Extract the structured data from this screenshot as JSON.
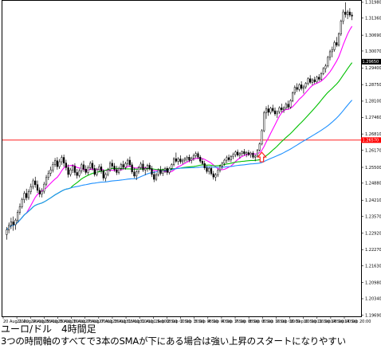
{
  "caption": {
    "title": "ユーロ/ドル　4時間足",
    "subtitle": "3つの時間軸のすべてで3本のSMAが下にある場合は強い上昇のスタートになりやすい"
  },
  "colors": {
    "background": "#ffffff",
    "candle_bull": "#ffffff",
    "candle_bear": "#000000",
    "candle_outline": "#000000",
    "sma_short": "#ff00ff",
    "sma_medium": "#00c000",
    "sma_long": "#1e90ff",
    "level_line": "#ff0000",
    "current_price_tag": "#000000",
    "arrow": "#ff2020"
  },
  "chart_data": {
    "type": "candlestick",
    "symbol": "EURUSD",
    "timeframe": "4H",
    "grid": false,
    "ylim": [
      1.1965,
      1.3204
    ],
    "y_ticks": [
      1.3198,
      1.3136,
      1.3069,
      1.3007,
      1.294,
      1.2875,
      1.281,
      1.2746,
      1.2681,
      1.2617,
      1.255,
      1.2488,
      1.2421,
      1.2357,
      1.2292,
      1.2227,
      1.2163,
      1.2098,
      1.2034,
      1.1969
    ],
    "y_tick_labels": [
      "1.31980",
      "1.31360",
      "1.30690",
      "1.30070",
      "1.29400",
      "1.28750",
      "1.28100",
      "1.27460",
      "1.26810",
      "1.26170",
      "1.25500",
      "1.24880",
      "1.24210",
      "1.23570",
      "1.22920",
      "1.22270",
      "1.21630",
      "1.20980",
      "1.20340",
      "1.19690"
    ],
    "x_tick_labels": [
      "20 Aug 2020",
      "21 Aug 16:00",
      "24 Aug 08:00",
      "25 Aug 00:00",
      "25 Aug 16:00",
      "26 Aug 08:00",
      "27 Aug 00:00",
      "27 Aug 16:00",
      "28 Aug 08:00",
      "31 Aug 00:00",
      "31 Aug 16:00",
      "1 Sep 08:00",
      "2 Sep 00:00",
      "2 Sep 16:00",
      "3 Sep 08:00",
      "4 Sep 00:00",
      "4 Sep 16:00",
      "7 Sep 08:00",
      "8 Sep 00:00",
      "8 Sep 16:00",
      "9 Sep 08:00",
      "10 Sep 00:00",
      "10 Sep 16:00",
      "11 Sep 08:00",
      "14 Sep 00:00",
      "14 Sep 20:00"
    ],
    "level_line": 1.2657,
    "level_line_label": "1.26570",
    "current_price_label": "1.29650",
    "current_price": 1.2965,
    "arrow": {
      "bar": 116,
      "price": 1.2578,
      "direction": "up"
    },
    "ohlc": [
      [
        1.2286,
        1.2316,
        1.2266,
        1.2305
      ],
      [
        1.2305,
        1.2333,
        1.2291,
        1.2322
      ],
      [
        1.2322,
        1.2352,
        1.2308,
        1.2336
      ],
      [
        1.2336,
        1.2357,
        1.2301,
        1.2325
      ],
      [
        1.2325,
        1.2349,
        1.2305,
        1.2343
      ],
      [
        1.2343,
        1.2383,
        1.2333,
        1.2374
      ],
      [
        1.2374,
        1.2408,
        1.2364,
        1.2396
      ],
      [
        1.2396,
        1.2431,
        1.2388,
        1.2423
      ],
      [
        1.2423,
        1.2457,
        1.241,
        1.2448
      ],
      [
        1.2448,
        1.2466,
        1.242,
        1.2431
      ],
      [
        1.2431,
        1.2464,
        1.2422,
        1.2455
      ],
      [
        1.2455,
        1.2486,
        1.2444,
        1.2474
      ],
      [
        1.2474,
        1.2506,
        1.2464,
        1.2497
      ],
      [
        1.2497,
        1.2513,
        1.247,
        1.2482
      ],
      [
        1.2482,
        1.2498,
        1.245,
        1.246
      ],
      [
        1.246,
        1.2471,
        1.2433,
        1.2445
      ],
      [
        1.2445,
        1.2468,
        1.2432,
        1.2456
      ],
      [
        1.2456,
        1.2493,
        1.2447,
        1.2484
      ],
      [
        1.2484,
        1.252,
        1.2476,
        1.251
      ],
      [
        1.251,
        1.2538,
        1.25,
        1.2527
      ],
      [
        1.2527,
        1.2553,
        1.2515,
        1.254
      ],
      [
        1.254,
        1.2572,
        1.253,
        1.2561
      ],
      [
        1.2561,
        1.2587,
        1.2552,
        1.2576
      ],
      [
        1.2576,
        1.259,
        1.2541,
        1.2553
      ],
      [
        1.2553,
        1.2583,
        1.2544,
        1.2572
      ],
      [
        1.2572,
        1.2598,
        1.256,
        1.2589
      ],
      [
        1.2589,
        1.26,
        1.2552,
        1.2567
      ],
      [
        1.2567,
        1.258,
        1.2538,
        1.2549
      ],
      [
        1.2549,
        1.2561,
        1.251,
        1.2522
      ],
      [
        1.2522,
        1.2548,
        1.2514,
        1.254
      ],
      [
        1.254,
        1.2562,
        1.2528,
        1.2554
      ],
      [
        1.2554,
        1.2566,
        1.2518,
        1.253
      ],
      [
        1.253,
        1.2544,
        1.2506,
        1.2518
      ],
      [
        1.2518,
        1.2545,
        1.251,
        1.2536
      ],
      [
        1.2536,
        1.2568,
        1.2526,
        1.256
      ],
      [
        1.256,
        1.2576,
        1.2532,
        1.2543
      ],
      [
        1.2543,
        1.2558,
        1.2521,
        1.253
      ],
      [
        1.253,
        1.2558,
        1.252,
        1.2549
      ],
      [
        1.2549,
        1.2574,
        1.254,
        1.2566
      ],
      [
        1.2566,
        1.2578,
        1.2537,
        1.2546
      ],
      [
        1.2546,
        1.256,
        1.2514,
        1.2522
      ],
      [
        1.2522,
        1.2548,
        1.2515,
        1.2541
      ],
      [
        1.2541,
        1.2562,
        1.2532,
        1.2552
      ],
      [
        1.2552,
        1.2564,
        1.2525,
        1.2535
      ],
      [
        1.2535,
        1.2542,
        1.2498,
        1.2508
      ],
      [
        1.2508,
        1.253,
        1.2495,
        1.2522
      ],
      [
        1.2522,
        1.2548,
        1.2515,
        1.254
      ],
      [
        1.254,
        1.2574,
        1.2532,
        1.2566
      ],
      [
        1.2566,
        1.258,
        1.2546,
        1.2555
      ],
      [
        1.2555,
        1.2567,
        1.2533,
        1.2541
      ],
      [
        1.2541,
        1.2556,
        1.252,
        1.253
      ],
      [
        1.253,
        1.2553,
        1.2522,
        1.2546
      ],
      [
        1.2546,
        1.2568,
        1.2537,
        1.2561
      ],
      [
        1.2561,
        1.2576,
        1.2544,
        1.255
      ],
      [
        1.255,
        1.2572,
        1.2541,
        1.2565
      ],
      [
        1.2565,
        1.2585,
        1.2555,
        1.2578
      ],
      [
        1.2578,
        1.2592,
        1.2552,
        1.256
      ],
      [
        1.256,
        1.257,
        1.2524,
        1.2532
      ],
      [
        1.2532,
        1.2548,
        1.2508,
        1.2516
      ],
      [
        1.2516,
        1.254,
        1.25,
        1.2532
      ],
      [
        1.2532,
        1.2556,
        1.2524,
        1.2549
      ],
      [
        1.2549,
        1.2572,
        1.2541,
        1.2563
      ],
      [
        1.2563,
        1.2578,
        1.2532,
        1.254
      ],
      [
        1.254,
        1.2553,
        1.252,
        1.2546
      ],
      [
        1.2546,
        1.2564,
        1.2533,
        1.2558
      ],
      [
        1.2558,
        1.2568,
        1.2538,
        1.2545
      ],
      [
        1.2545,
        1.2556,
        1.2512,
        1.2522
      ],
      [
        1.2522,
        1.2534,
        1.2492,
        1.2503
      ],
      [
        1.2503,
        1.2528,
        1.2496,
        1.2521
      ],
      [
        1.2521,
        1.2546,
        1.2514,
        1.254
      ],
      [
        1.254,
        1.2555,
        1.2518,
        1.2526
      ],
      [
        1.2526,
        1.2545,
        1.2516,
        1.2538
      ],
      [
        1.2538,
        1.2552,
        1.2528,
        1.2546
      ],
      [
        1.2546,
        1.2554,
        1.252,
        1.253
      ],
      [
        1.253,
        1.2552,
        1.2522,
        1.2546
      ],
      [
        1.2546,
        1.2566,
        1.2538,
        1.2561
      ],
      [
        1.2561,
        1.259,
        1.2554,
        1.2584
      ],
      [
        1.2584,
        1.2608,
        1.2568,
        1.2574
      ],
      [
        1.2574,
        1.259,
        1.256,
        1.2583
      ],
      [
        1.2583,
        1.2597,
        1.2564,
        1.2572
      ],
      [
        1.2572,
        1.2585,
        1.2562,
        1.2578
      ],
      [
        1.2578,
        1.259,
        1.2568,
        1.2584
      ],
      [
        1.2584,
        1.2596,
        1.2572,
        1.259
      ],
      [
        1.259,
        1.26,
        1.257,
        1.2578
      ],
      [
        1.2578,
        1.2592,
        1.2565,
        1.2586
      ],
      [
        1.2586,
        1.2604,
        1.2576,
        1.2596
      ],
      [
        1.2596,
        1.2612,
        1.2586,
        1.2604
      ],
      [
        1.2604,
        1.2612,
        1.2582,
        1.259
      ],
      [
        1.259,
        1.2598,
        1.2566,
        1.2574
      ],
      [
        1.2574,
        1.2585,
        1.2558,
        1.2565
      ],
      [
        1.2565,
        1.2576,
        1.254,
        1.2548
      ],
      [
        1.2548,
        1.2558,
        1.2526,
        1.2534
      ],
      [
        1.2534,
        1.2552,
        1.2522,
        1.2546
      ],
      [
        1.2546,
        1.2554,
        1.2518,
        1.2525
      ],
      [
        1.2525,
        1.2536,
        1.2502,
        1.2512
      ],
      [
        1.2512,
        1.2528,
        1.2496,
        1.252
      ],
      [
        1.252,
        1.2545,
        1.2512,
        1.2538
      ],
      [
        1.2538,
        1.256,
        1.253,
        1.2555
      ],
      [
        1.2555,
        1.2572,
        1.2544,
        1.2566
      ],
      [
        1.2566,
        1.2584,
        1.2556,
        1.2578
      ],
      [
        1.2578,
        1.2596,
        1.2566,
        1.2588
      ],
      [
        1.2588,
        1.26,
        1.2572,
        1.258
      ],
      [
        1.258,
        1.2598,
        1.257,
        1.2592
      ],
      [
        1.2592,
        1.2608,
        1.2582,
        1.26
      ],
      [
        1.26,
        1.2616,
        1.259,
        1.261
      ],
      [
        1.261,
        1.262,
        1.2592,
        1.2598
      ],
      [
        1.2598,
        1.261,
        1.2584,
        1.2604
      ],
      [
        1.2604,
        1.2616,
        1.2594,
        1.2612
      ],
      [
        1.2612,
        1.2622,
        1.2596,
        1.2603
      ],
      [
        1.2603,
        1.2614,
        1.259,
        1.2608
      ],
      [
        1.2608,
        1.2618,
        1.2594,
        1.26
      ],
      [
        1.26,
        1.2612,
        1.2588,
        1.2606
      ],
      [
        1.2606,
        1.2614,
        1.2584,
        1.259
      ],
      [
        1.259,
        1.26,
        1.2574,
        1.2594
      ],
      [
        1.2594,
        1.2622,
        1.259,
        1.2618
      ],
      [
        1.2618,
        1.2648,
        1.2612,
        1.2642
      ],
      [
        1.2642,
        1.27,
        1.2636,
        1.2694
      ],
      [
        1.2694,
        1.2772,
        1.2688,
        1.2764
      ],
      [
        1.2764,
        1.279,
        1.274,
        1.278
      ],
      [
        1.278,
        1.2795,
        1.2752,
        1.2766
      ],
      [
        1.2766,
        1.2788,
        1.2758,
        1.2782
      ],
      [
        1.2782,
        1.2796,
        1.2765,
        1.2772
      ],
      [
        1.2772,
        1.2785,
        1.2752,
        1.276
      ],
      [
        1.276,
        1.2774,
        1.2744,
        1.2768
      ],
      [
        1.2768,
        1.279,
        1.276,
        1.2784
      ],
      [
        1.2784,
        1.28,
        1.2766,
        1.2776
      ],
      [
        1.2776,
        1.279,
        1.2764,
        1.2783
      ],
      [
        1.2783,
        1.2805,
        1.2776,
        1.2798
      ],
      [
        1.2798,
        1.2812,
        1.2778,
        1.2786
      ],
      [
        1.2786,
        1.2818,
        1.278,
        1.2812
      ],
      [
        1.2812,
        1.2848,
        1.2806,
        1.2842
      ],
      [
        1.2842,
        1.2872,
        1.2834,
        1.2864
      ],
      [
        1.2864,
        1.288,
        1.2846,
        1.2856
      ],
      [
        1.2856,
        1.288,
        1.2848,
        1.2874
      ],
      [
        1.2874,
        1.2888,
        1.2852,
        1.286
      ],
      [
        1.286,
        1.2874,
        1.284,
        1.2866
      ],
      [
        1.2866,
        1.2885,
        1.2858,
        1.288
      ],
      [
        1.288,
        1.2904,
        1.2872,
        1.2898
      ],
      [
        1.2898,
        1.2912,
        1.2878,
        1.2884
      ],
      [
        1.2884,
        1.29,
        1.2872,
        1.2894
      ],
      [
        1.2894,
        1.2906,
        1.2878,
        1.2886
      ],
      [
        1.2886,
        1.291,
        1.288,
        1.2904
      ],
      [
        1.2904,
        1.2916,
        1.2888,
        1.2896
      ],
      [
        1.2896,
        1.2924,
        1.289,
        1.2918
      ],
      [
        1.2918,
        1.2944,
        1.2912,
        1.2938
      ],
      [
        1.2938,
        1.2956,
        1.2922,
        1.2948
      ],
      [
        1.2948,
        1.2988,
        1.2942,
        1.2982
      ],
      [
        1.2982,
        1.3012,
        1.297,
        1.3004
      ],
      [
        1.3004,
        1.3024,
        1.2982,
        1.3012
      ],
      [
        1.3012,
        1.3048,
        1.3004,
        1.304
      ],
      [
        1.304,
        1.3062,
        1.3022,
        1.303
      ],
      [
        1.303,
        1.308,
        1.3024,
        1.3074
      ],
      [
        1.3074,
        1.313,
        1.3066,
        1.3124
      ],
      [
        1.3124,
        1.317,
        1.3112,
        1.316
      ],
      [
        1.316,
        1.3198,
        1.3138,
        1.315
      ],
      [
        1.315,
        1.3168,
        1.3132,
        1.316
      ],
      [
        1.316,
        1.3175,
        1.314,
        1.3148
      ],
      [
        1.3148,
        1.316,
        1.3128,
        1.3144
      ]
    ],
    "series": [
      {
        "kind": "sma_short",
        "period": 10
      },
      {
        "kind": "sma_medium",
        "period": 30
      },
      {
        "kind": "sma_long",
        "period": 60
      }
    ]
  }
}
